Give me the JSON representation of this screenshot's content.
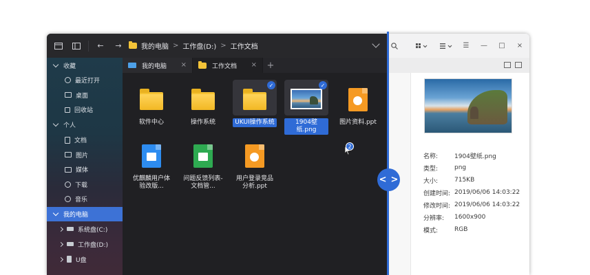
{
  "toolbar": {
    "nav_back": "←",
    "nav_forward": "→",
    "breadcrumb": [
      "我的电脑",
      "工作盘(D:)",
      "工作文档"
    ],
    "crumb_sep": ">"
  },
  "sidebar": {
    "groups": [
      {
        "label": "收藏",
        "items": [
          "最近打开",
          "桌面",
          "回收站"
        ]
      },
      {
        "label": "个人",
        "items": [
          "文档",
          "图片",
          "媒体",
          "下载",
          "音乐"
        ]
      }
    ],
    "computer": {
      "label": "我的电脑",
      "drives": [
        "系统盘(C:)",
        "工作盘(D:)",
        "U盘"
      ]
    }
  },
  "tabs": [
    {
      "label": "我的电脑",
      "close": "×"
    },
    {
      "label": "工作文档",
      "close": "×"
    }
  ],
  "tab_add": "+",
  "files": [
    {
      "name": "软件中心",
      "type": "folder",
      "selected": false
    },
    {
      "name": "操作系统",
      "type": "folder",
      "selected": false
    },
    {
      "name": "UKUI操作系统",
      "type": "folder",
      "selected": true
    },
    {
      "name": "1904壁纸.png",
      "type": "image",
      "selected": true
    },
    {
      "name": "图片资料.ppt",
      "type": "ppt",
      "selected": false
    },
    {
      "name": "优麒麟用户体验改版...",
      "type": "doc",
      "selected": false
    },
    {
      "name": "问题反馈列表-文档管...",
      "type": "sheet",
      "selected": false
    },
    {
      "name": "用户登录竞品分析.ppt",
      "type": "ppt",
      "selected": false
    }
  ],
  "check_mark": "✓",
  "drag_badge": "2",
  "handle": {
    "left": "<",
    "right": ">"
  },
  "right_toolbar": {
    "menu": "☰",
    "minimize": "—",
    "maximize": "□",
    "close": "×"
  },
  "details": {
    "rows": [
      {
        "key": "名称:",
        "value": "1904壁纸.png"
      },
      {
        "key": "类型:",
        "value": "png"
      },
      {
        "key": "大小:",
        "value": "715KB"
      },
      {
        "key": "创建时间:",
        "value": "2019/06/06  14:03:22"
      },
      {
        "key": "修改时间:",
        "value": "2019/06/06  14:03:22"
      },
      {
        "key": "分辨率:",
        "value": "1600x900"
      },
      {
        "key": "模式:",
        "value": "RGB"
      }
    ]
  },
  "colors": {
    "accent": "#2f6bd6",
    "folder": "#f5c232",
    "dark_bg": "#202023"
  }
}
